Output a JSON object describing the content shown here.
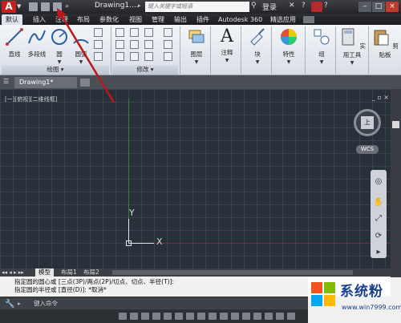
{
  "titlebar": {
    "logo": "A",
    "title": "Drawing1....",
    "search_placeholder": "键入关键字或短语",
    "login": "登录"
  },
  "menu_tabs": [
    "默认",
    "插入",
    "注释",
    "布局",
    "参数化",
    "视图",
    "管理",
    "输出",
    "插件",
    "Autodesk 360",
    "精选应用"
  ],
  "ribbon": {
    "draw_tools": {
      "line": "直线",
      "polyline": "多段线",
      "circle": "圆",
      "arc": "圆弧"
    },
    "panel_draw": "绘图",
    "panel_modify": "修改",
    "layers": "图层",
    "annotation": "注释",
    "block": "块",
    "properties": "特性",
    "group": "组",
    "utilities": "实用工具",
    "clipboard": "剪贴板"
  },
  "file_tab": "Drawing1*",
  "viewport": {
    "label": "[一][俯视][二维线框]",
    "winctrl": "_ ▫ ×",
    "ucs_y": "Y",
    "ucs_x": "X",
    "viewcube_face": "上",
    "wcs": "WCS"
  },
  "layout_tabs": [
    "模型",
    "布局1",
    "布局2"
  ],
  "command": {
    "line1": "指定圆的圆心或 [三点(3P)/两点(2P)/切点、切点、半径(T)]:",
    "line2": "指定圆的半径或 [直径(D)]: *取消*",
    "placeholder": "键入命令"
  },
  "watermark": {
    "name": "系统粉",
    "url": "www.win7999.com"
  }
}
